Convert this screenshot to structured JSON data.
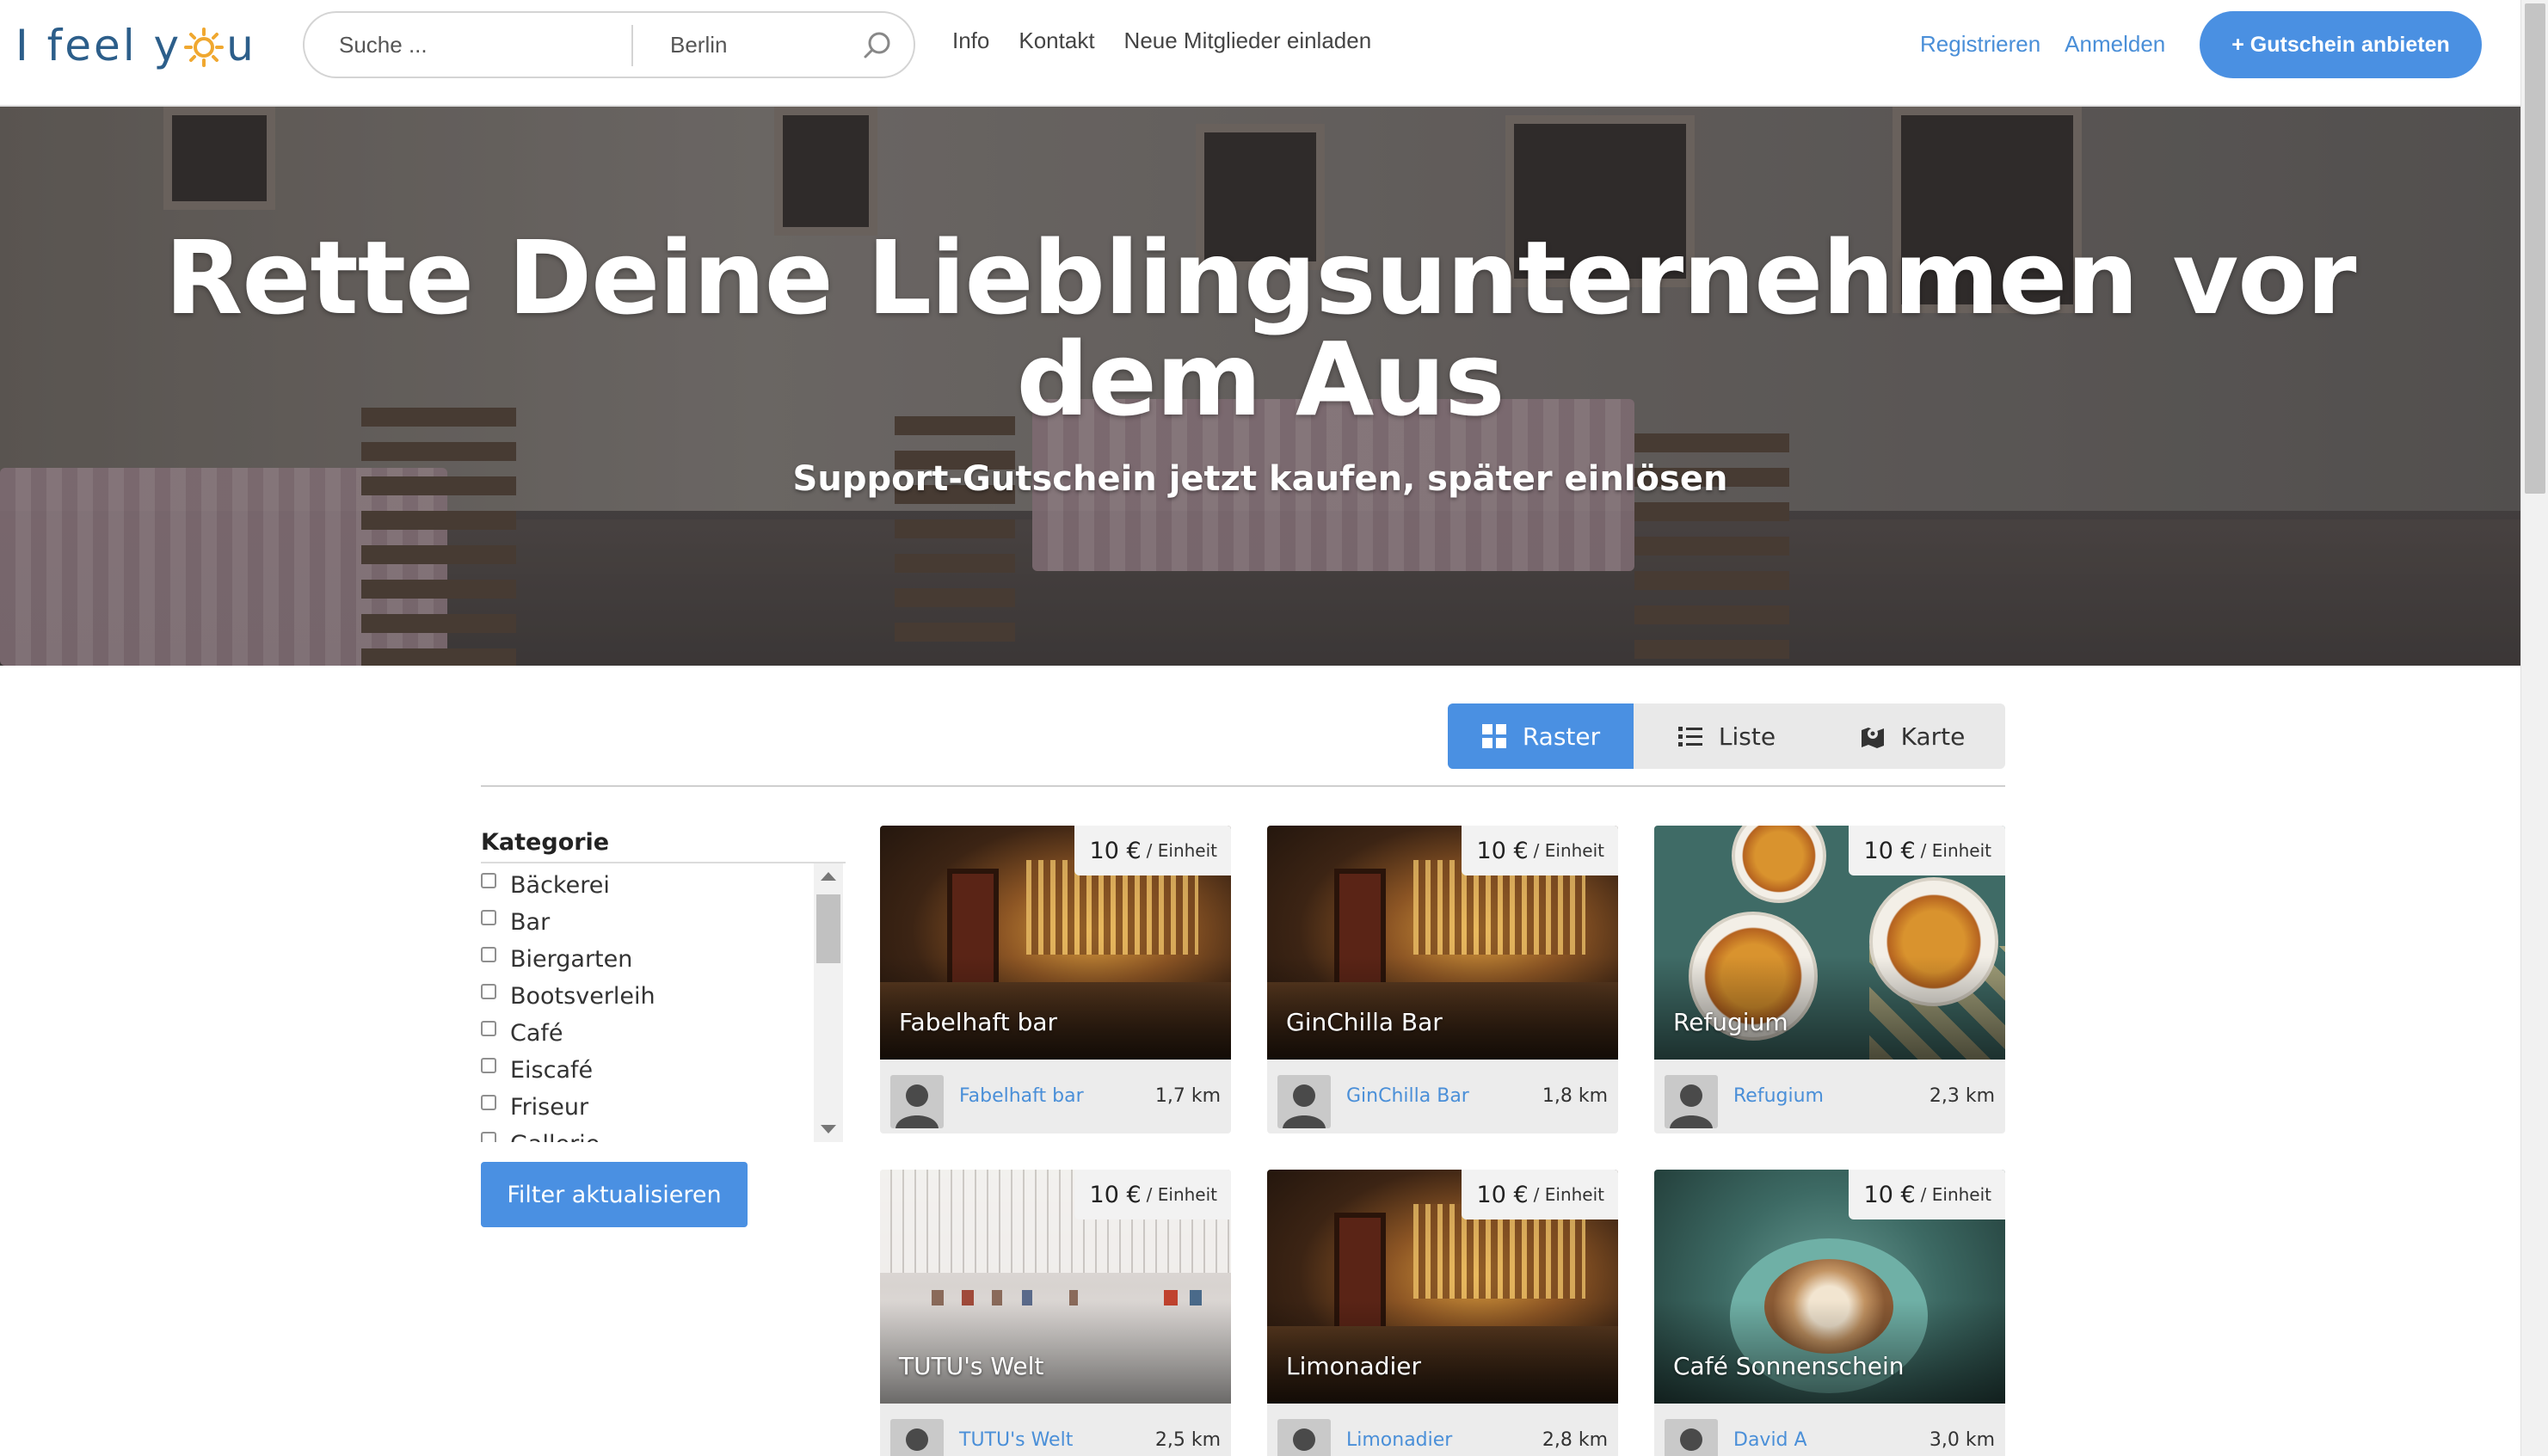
{
  "header": {
    "logo_text_left": "I feel y",
    "logo_text_right": "u",
    "search_placeholder": "Suche ...",
    "location_placeholder": "Berlin",
    "nav": [
      "Info",
      "Kontakt",
      "Neue Mitglieder einladen"
    ],
    "register_label": "Registrieren",
    "login_label": "Anmelden",
    "cta_label": "+ Gutschein anbieten"
  },
  "hero": {
    "title": "Rette Deine Lieblingsunternehmen vor dem Aus",
    "subtitle": "Support-Gutschein jetzt kaufen, später einlösen"
  },
  "views": {
    "grid_label": "Raster",
    "list_label": "Liste",
    "map_label": "Karte",
    "active": "grid"
  },
  "filter": {
    "title": "Kategorie",
    "items": [
      "Bäckerei",
      "Bar",
      "Biergarten",
      "Bootsverleih",
      "Café",
      "Eiscafé",
      "Friseur",
      "Gallerie"
    ],
    "button_label": "Filter aktualisieren"
  },
  "cards": [
    {
      "title": "Fabelhaft bar",
      "price": "10 €",
      "unit": "/ Einheit",
      "owner": "Fabelhaft bar",
      "distance": "1,7 km",
      "photo": "bar"
    },
    {
      "title": "GinChilla Bar",
      "price": "10 €",
      "unit": "/ Einheit",
      "owner": "GinChilla Bar",
      "distance": "1,8 km",
      "photo": "bar"
    },
    {
      "title": "Refugium",
      "price": "10 €",
      "unit": "/ Einheit",
      "owner": "Refugium",
      "distance": "2,3 km",
      "photo": "food"
    },
    {
      "title": "TUTU's Welt",
      "price": "10 €",
      "unit": "/ Einheit",
      "owner": "TUTU's Welt",
      "distance": "2,5 km",
      "photo": "gallery"
    },
    {
      "title": "Limonadier",
      "price": "10 €",
      "unit": "/ Einheit",
      "owner": "Limonadier",
      "distance": "2,8 km",
      "photo": "bar"
    },
    {
      "title": "Café Sonnenschein",
      "price": "10 €",
      "unit": "/ Einheit",
      "owner": "David A",
      "distance": "3,0 km",
      "photo": "cafe"
    }
  ],
  "colors": {
    "accent": "#4a90e2",
    "link": "#4a8fd8",
    "logo": "#2c5e8a",
    "logo_sun": "#f0a830"
  }
}
